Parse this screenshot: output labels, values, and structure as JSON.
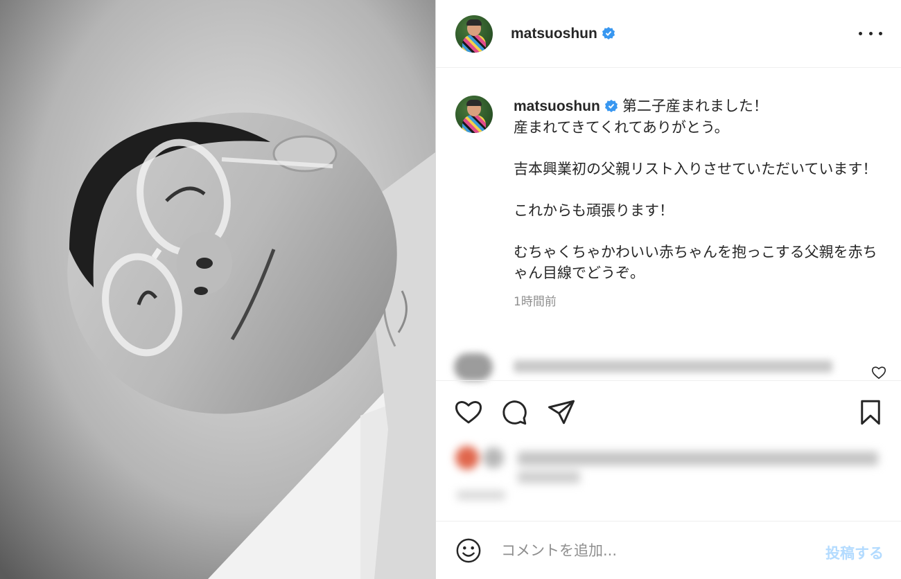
{
  "post": {
    "username": "matsuoshun",
    "verified": true,
    "caption": "第二子産まれました！\n産まれてきてくれてありがとう。\n\n吉本興業初の父親リスト入りさせていただいています！\n\nこれからも頑張ります！\n\nむちゃくちゃかわいい赤ちゃんを抱っこする父親を赤ちゃん目線でどうぞ。",
    "time": "1時間前"
  },
  "comment": {
    "placeholder": "コメントを追加...",
    "post_label": "投稿する"
  },
  "colors": {
    "verified": "#3897f0",
    "post_disabled": "#b3dbff",
    "text": "#262626",
    "muted": "#8e8e8e"
  },
  "icons": [
    "heart-icon",
    "comment-icon",
    "share-icon",
    "bookmark-icon",
    "emoji-icon",
    "more-icon",
    "verified-badge-icon"
  ]
}
